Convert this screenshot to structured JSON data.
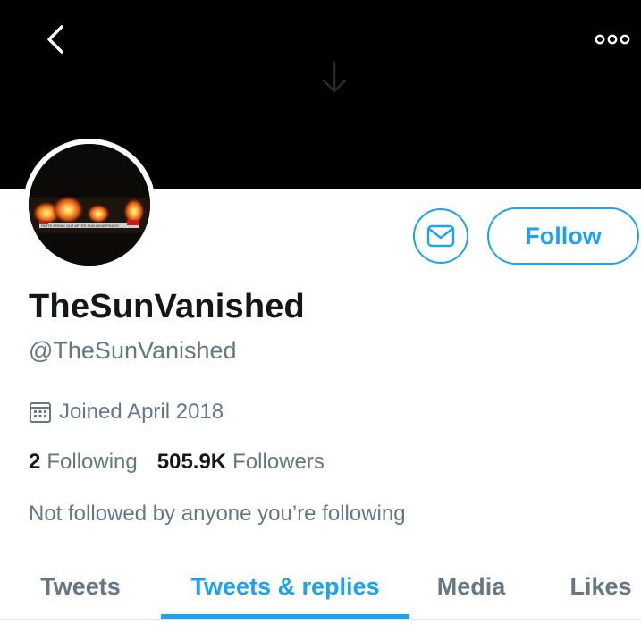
{
  "header": {
    "back_icon": "chevron-left-icon",
    "more_icon": "more-horizontal-icon",
    "banner_icon": "down-arrow-icon"
  },
  "profile": {
    "avatar_caption": "RIOTS BREAK OUT AFTER SUN DISAPPEARS",
    "display_name": "TheSunVanished",
    "handle": "@TheSunVanished",
    "joined": "Joined April 2018",
    "following_count": "2",
    "following_label": "Following",
    "followers_count": "505.9K",
    "followers_label": "Followers",
    "not_followed": "Not followed by anyone you’re following"
  },
  "actions": {
    "message_icon": "envelope-icon",
    "follow_label": "Follow"
  },
  "tabs": [
    {
      "label": "Tweets",
      "active": false
    },
    {
      "label": "Tweets & replies",
      "active": true
    },
    {
      "label": "Media",
      "active": false
    },
    {
      "label": "Likes",
      "active": false
    }
  ],
  "colors": {
    "accent": "#1da1f2",
    "secondary_text": "#657786",
    "primary_text": "#14171a",
    "banner": "#000000"
  }
}
